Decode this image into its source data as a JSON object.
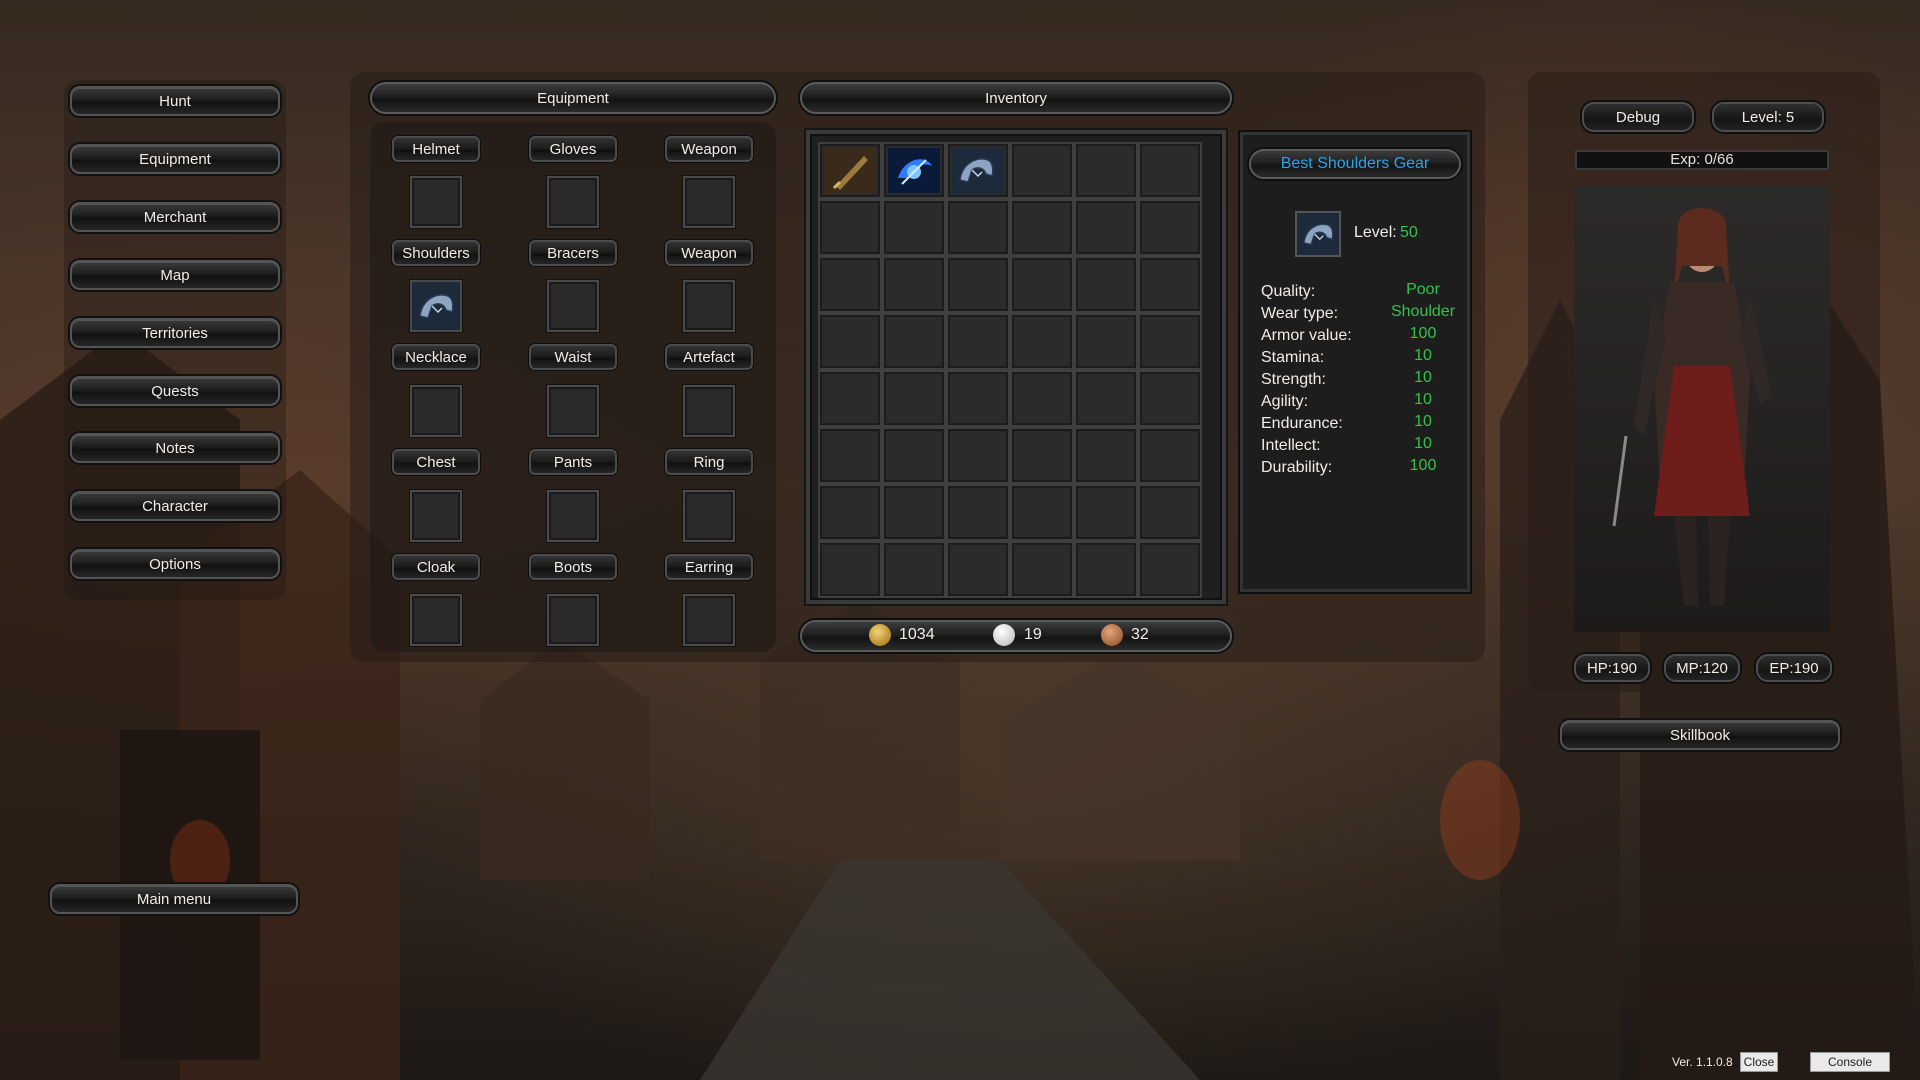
{
  "sidebar": {
    "items": [
      "Hunt",
      "Equipment",
      "Merchant",
      "Map",
      "Territories",
      "Quests",
      "Notes",
      "Character",
      "Options"
    ],
    "main_menu": "Main menu"
  },
  "equipment": {
    "title": "Equipment",
    "slots": [
      "Helmet",
      "Gloves",
      "Weapon",
      "Shoulders",
      "Bracers",
      "Weapon",
      "Necklace",
      "Waist",
      "Artefact",
      "Chest",
      "Pants",
      "Ring",
      "Cloak",
      "Boots",
      "Earring"
    ],
    "equipped": {
      "Shoulders": "shoulder-armor-icon"
    }
  },
  "inventory": {
    "title": "Inventory",
    "columns": 6,
    "rows": 8,
    "items": [
      {
        "slot": 0,
        "icon": "dagger-icon"
      },
      {
        "slot": 1,
        "icon": "blue-gem-icon"
      },
      {
        "slot": 2,
        "icon": "shoulder-armor-icon"
      }
    ]
  },
  "currency": {
    "gold": "1034",
    "silver": "19",
    "copper": "32",
    "colors": {
      "gold": "#c9a23a",
      "silver": "#d9d9d9",
      "copper": "#a86a3e"
    }
  },
  "item_tooltip": {
    "name": "Best Shoulders Gear",
    "level_label": "Level:",
    "level": "50",
    "stats": [
      {
        "label": "Quality:",
        "value": "Poor"
      },
      {
        "label": "Wear type:",
        "value": "Shoulder"
      },
      {
        "label": "Armor value:",
        "value": "100"
      },
      {
        "label": "Stamina:",
        "value": "10"
      },
      {
        "label": "Strength:",
        "value": "10"
      },
      {
        "label": "Agility:",
        "value": "10"
      },
      {
        "label": "Endurance:",
        "value": "10"
      },
      {
        "label": "Intellect:",
        "value": "10"
      },
      {
        "label": "Durability:",
        "value": "100"
      }
    ],
    "name_color": "#2ba3e8",
    "value_color": "#36c24a"
  },
  "character": {
    "debug_label": "Debug",
    "level_label": "Level: 5",
    "exp_label": "Exp: 0/66",
    "exp_fraction": 0,
    "hp": "HP:190",
    "mp": "MP:120",
    "ep": "EP:190",
    "skillbook": "Skillbook"
  },
  "footer": {
    "version": "Ver. 1.1.0.8",
    "close": "Close",
    "console": "Console"
  }
}
